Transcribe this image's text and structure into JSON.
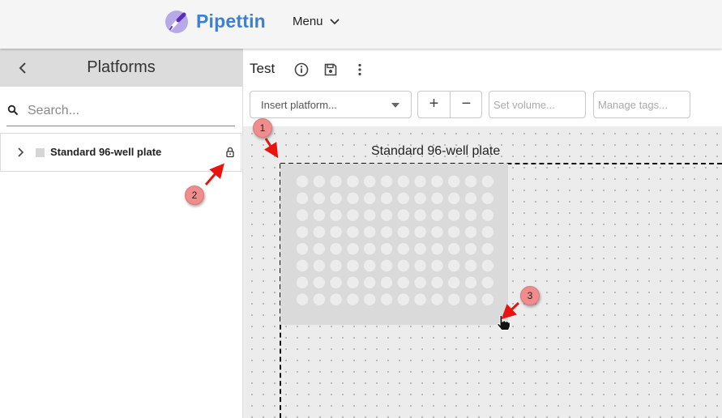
{
  "header": {
    "brand": "Pipettin",
    "menu_label": "Menu",
    "logo_icon": "pipette-logo-icon",
    "brand_color": "#3d7fd1"
  },
  "sidebar": {
    "title": "Platforms",
    "back_icon": "chevron-left-icon",
    "search": {
      "placeholder": "Search...",
      "value": ""
    },
    "items": [
      {
        "label": "Standard 96-well plate",
        "locked": true,
        "expanded": false
      }
    ]
  },
  "workspace": {
    "title": "Test",
    "toolbar_icons": [
      "info-icon",
      "save-icon",
      "more-vert-icon"
    ],
    "insert_platform": {
      "placeholder": "Insert platform..."
    },
    "stepper": {
      "plus": "+",
      "minus": "−"
    },
    "set_volume": {
      "placeholder": "Set volume..."
    },
    "manage_tags": {
      "placeholder": "Manage tags..."
    },
    "platform_label": "Standard 96-well plate",
    "plate": {
      "rows": 8,
      "columns": 12
    }
  },
  "annotations": [
    "1",
    "2",
    "3"
  ],
  "colors": {
    "annotation_badge": "#f08c8c",
    "annotation_arrow": "#e8140f",
    "canvas_bg": "#ececec",
    "plate_bg": "#dadada"
  }
}
